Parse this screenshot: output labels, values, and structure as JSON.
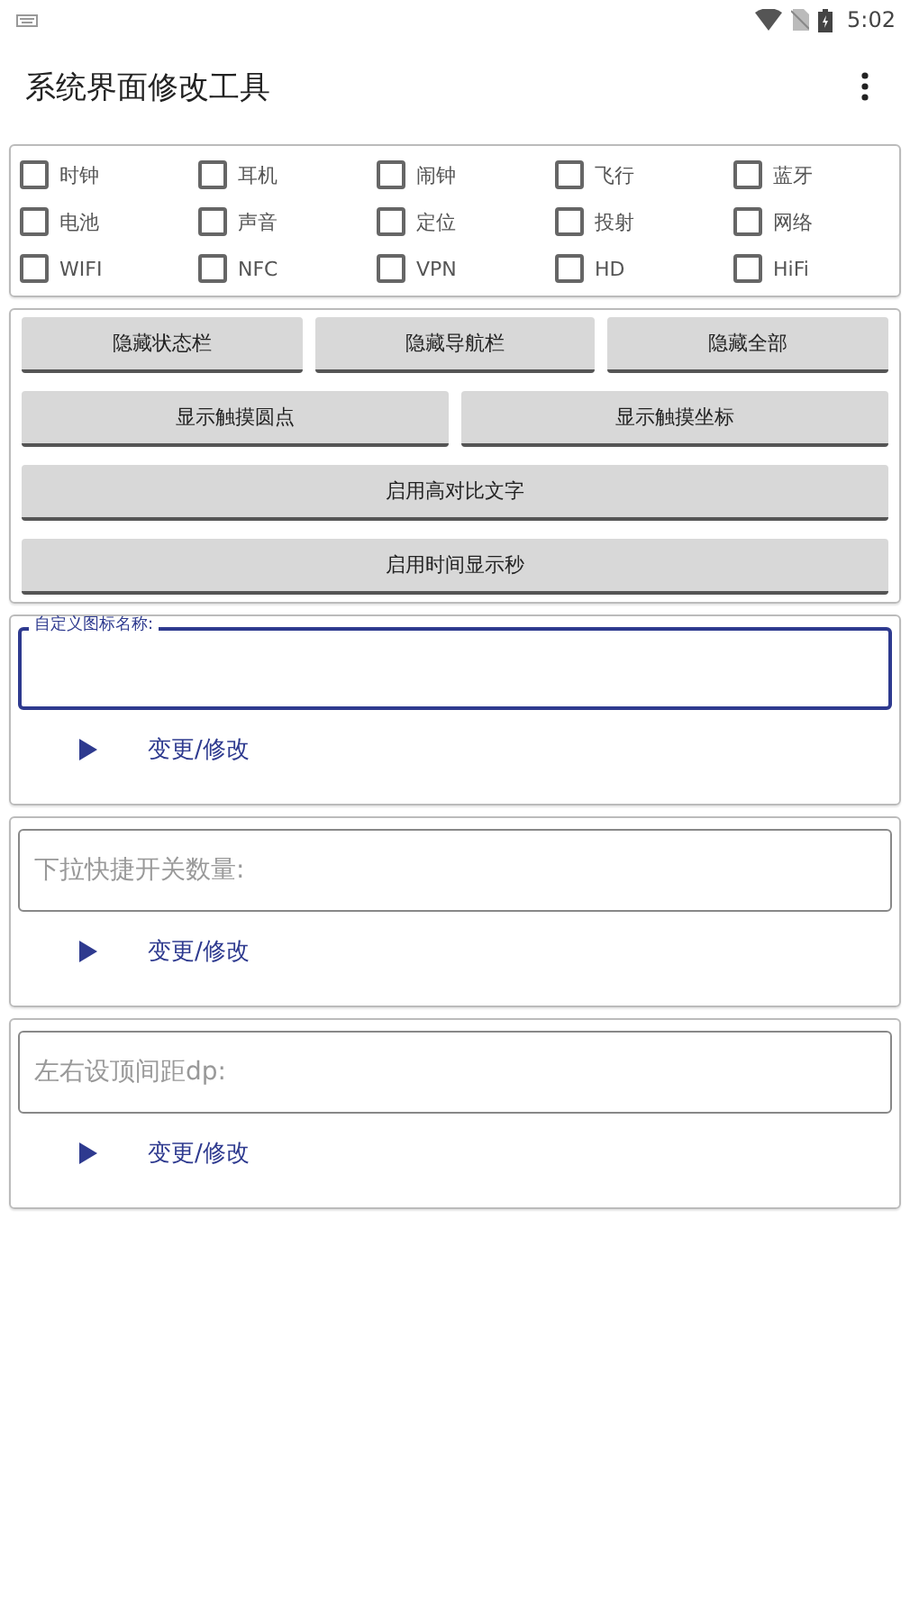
{
  "status_bar": {
    "time": "5:02"
  },
  "app_bar": {
    "title": "系统界面修改工具"
  },
  "checkbox_rows": [
    [
      {
        "label": "时钟",
        "checked": false
      },
      {
        "label": "耳机",
        "checked": false
      },
      {
        "label": "闹钟",
        "checked": false
      },
      {
        "label": "飞行",
        "checked": false
      },
      {
        "label": "蓝牙",
        "checked": false
      }
    ],
    [
      {
        "label": "电池",
        "checked": false
      },
      {
        "label": "声音",
        "checked": false
      },
      {
        "label": "定位",
        "checked": false
      },
      {
        "label": "投射",
        "checked": false
      },
      {
        "label": "网络",
        "checked": false
      }
    ],
    [
      {
        "label": "WIFI",
        "checked": false
      },
      {
        "label": "NFC",
        "checked": false
      },
      {
        "label": "VPN",
        "checked": false
      },
      {
        "label": "HD",
        "checked": false
      },
      {
        "label": "HiFi",
        "checked": false
      }
    ]
  ],
  "button_rows": [
    [
      "隐藏状态栏",
      "隐藏导航栏",
      "隐藏全部"
    ],
    [
      "显示触摸圆点",
      "显示触摸坐标"
    ],
    [
      "启用高对比文字"
    ],
    [
      "启用时间显示秒"
    ]
  ],
  "field_cards": [
    {
      "label": "自定义图标名称:",
      "focused": true,
      "action": "变更/修改"
    },
    {
      "placeholder": "下拉快捷开关数量:",
      "focused": false,
      "action": "变更/修改"
    },
    {
      "placeholder": "左右设顶间距dp:",
      "focused": false,
      "action": "变更/修改"
    }
  ]
}
